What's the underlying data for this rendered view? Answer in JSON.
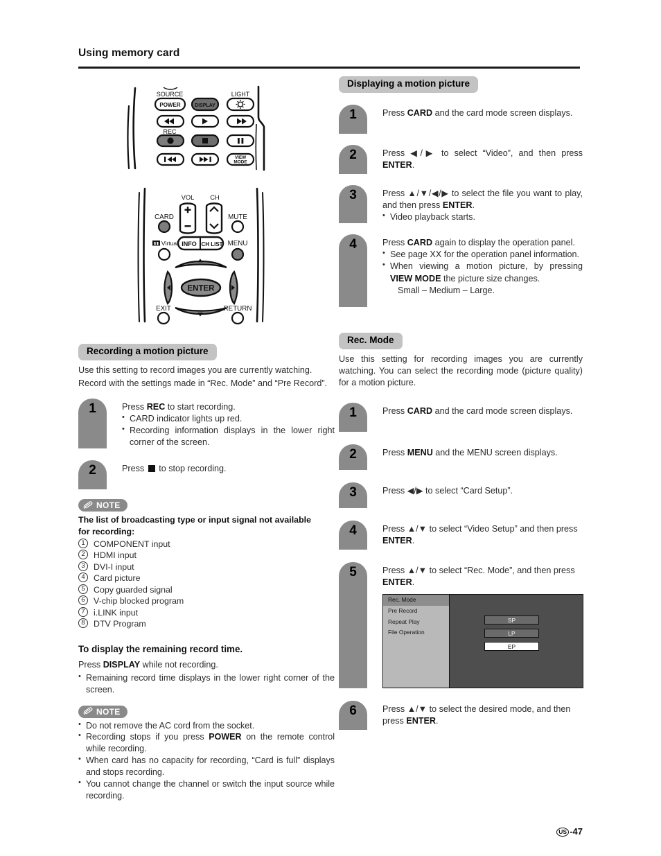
{
  "header": {
    "title": "Using memory card"
  },
  "footer": {
    "region_badge": "US",
    "page_number": "-47"
  },
  "remote_top": {
    "labels": {
      "source": "SOURCE",
      "light": "LIGHT",
      "rec": "REC"
    },
    "buttons": {
      "power": "POWER",
      "display": "DISPLAY",
      "light": "light-icon",
      "rewind": "rewind-icon",
      "play": "play-icon",
      "fast_forward": "fast-forward-icon",
      "record": "record-icon",
      "stop": "stop-icon",
      "pause": "pause-icon",
      "prev_track": "previous-track-icon",
      "next_track": "next-track-icon",
      "view_mode_line1": "VIEW",
      "view_mode_line2": "MODE"
    }
  },
  "remote_bottom": {
    "labels": {
      "vol": "VOL",
      "ch": "CH",
      "card": "CARD",
      "mute": "MUTE",
      "virtual": "Virtual",
      "menu": "MENU",
      "exit": "EXIT",
      "return": "RETURN"
    },
    "buttons": {
      "vol_plus": "+",
      "vol_minus": "−",
      "ch_up": "chevron-up-icon",
      "ch_down": "chevron-down-icon",
      "info": "INFO",
      "ch_list": "CH LIST",
      "enter": "ENTER",
      "up": "up-arrow-icon",
      "down": "down-arrow-icon",
      "left": "left-arrow-icon",
      "right": "right-arrow-icon"
    }
  },
  "left_column": {
    "recording_section": {
      "heading": "Recording a motion picture",
      "intro_line1": "Use this setting to record images you are currently watching.",
      "intro_line2": "Record with the settings made in “Rec. Mode” and “Pre Record”.",
      "steps": [
        {
          "number": "1",
          "text_pre": "Press ",
          "text_bold": "REC",
          "text_post": " to start recording.",
          "bullets": [
            "CARD indicator lights up red.",
            "Recording information displays in the lower right corner of the screen."
          ]
        },
        {
          "number": "2",
          "text_pre": "Press ",
          "glyph": "stop-square",
          "text_post": " to stop recording."
        }
      ]
    },
    "note_one": {
      "badge_label": "NOTE",
      "title_line1": "The list of broadcasting type or input signal not available",
      "title_line2": "for recording:",
      "items": [
        {
          "num": "1",
          "text": "COMPONENT input"
        },
        {
          "num": "2",
          "text": "HDMI input"
        },
        {
          "num": "3",
          "text": "DVI-I input"
        },
        {
          "num": "4",
          "text": "Card picture"
        },
        {
          "num": "5",
          "text": "Copy guarded signal"
        },
        {
          "num": "6",
          "text": "V-chip blocked program"
        },
        {
          "num": "7",
          "text": "i.LINK input"
        },
        {
          "num": "8",
          "text": "DTV Program"
        }
      ]
    },
    "remaining_time": {
      "heading": "To display the remaining record time.",
      "line_pre": "Press ",
      "line_bold": "DISPLAY",
      "line_post": " while not recording.",
      "bullet": "Remaining record time displays in the lower right corner of the screen."
    },
    "note_two": {
      "badge_label": "NOTE",
      "bullets": [
        {
          "pre": "Do not remove the AC cord from the socket.",
          "bold": "",
          "post": ""
        },
        {
          "pre": "Recording stops if you press ",
          "bold": "POWER",
          "post": " on the remote control while recording."
        },
        {
          "pre": "When card has no capacity for recording, “Card is full” displays and stops recording.",
          "bold": "",
          "post": ""
        },
        {
          "pre": "You cannot change the channel or switch the input source while recording.",
          "bold": "",
          "post": ""
        }
      ]
    }
  },
  "right_column": {
    "displaying_section": {
      "heading": "Displaying a motion picture",
      "steps": [
        {
          "number": "1",
          "pre": "Press ",
          "bold": "CARD",
          "post": " and the card mode screen displays."
        },
        {
          "number": "2",
          "pre": "Press ◀/▶ to select “Video”, and then press ",
          "bold": "ENTER",
          "post": "."
        },
        {
          "number": "3",
          "pre": "Press ▲/▼/◀/▶ to select the file you want to play, and then press ",
          "bold": "ENTER",
          "post": ".",
          "bullets": [
            "Video playback starts."
          ]
        },
        {
          "number": "4",
          "pre": "Press ",
          "bold": "CARD",
          "post": " again to display the operation panel.",
          "bullet_1": "See page XX for the operation panel information.",
          "bullet_2_pre": "When viewing a motion picture, by pressing ",
          "bullet_2_bold": "VIEW MODE",
          "bullet_2_post": " the picture size changes.",
          "bullet_2_sub": "Small – Medium – Large."
        }
      ]
    },
    "rec_mode_section": {
      "heading": "Rec. Mode",
      "intro": "Use this setting for recording images you are currently watching. You can select the recording mode (picture quality) for a motion picture.",
      "steps": [
        {
          "number": "1",
          "pre": "Press ",
          "bold": "CARD",
          "post": " and the card mode screen displays."
        },
        {
          "number": "2",
          "pre": "Press ",
          "bold": "MENU",
          "post": " and the MENU screen displays."
        },
        {
          "number": "3",
          "pre": "Press ◀/▶ to select “Card Setup”.",
          "bold": "",
          "post": ""
        },
        {
          "number": "4",
          "pre": "Press ▲/▼ to select “Video Setup” and then press ",
          "bold": "ENTER",
          "post": "."
        },
        {
          "number": "5",
          "pre": "Press ▲/▼ to select “Rec. Mode”, and then press ",
          "bold": "ENTER",
          "post": "."
        },
        {
          "number": "6",
          "pre": "Press ▲/▼ to select the desired mode, and then press ",
          "bold": "ENTER",
          "post": "."
        }
      ],
      "osd": {
        "menu_items": [
          {
            "label": "Rec. Mode",
            "selected": true
          },
          {
            "label": "Pre Record",
            "selected": false
          },
          {
            "label": "Repeat Play",
            "selected": false
          },
          {
            "label": "File Operation",
            "selected": false
          }
        ],
        "options": [
          {
            "label": "SP",
            "highlighted": false
          },
          {
            "label": "LP",
            "highlighted": false
          },
          {
            "label": "EP",
            "highlighted": true
          }
        ]
      }
    }
  },
  "colors": {
    "section_pill": "#c3c3c3",
    "step_badge": "#8a8a8a",
    "note_badge": "#8a8a8a",
    "osd_sidebar": "#b9b9b9",
    "osd_main": "#4e4e4e",
    "osd_option_dim": "#6a6a6a",
    "osd_option_highlight": "#ffffff",
    "rule": "#1a1a1a"
  }
}
